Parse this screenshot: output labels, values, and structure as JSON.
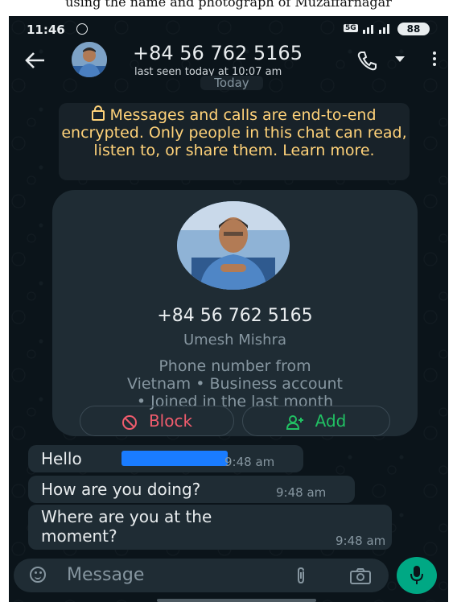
{
  "caption": "using the name and photograph of Muzaffarnagar",
  "status_bar": {
    "time": "11:46",
    "network_badge": "5G",
    "battery": "88"
  },
  "header": {
    "title": "+84 56 762 5165",
    "subtitle": "last seen today at 10:07 am"
  },
  "date_chip": "Today",
  "encryption_notice": "Messages and calls are end-to-end encrypted. Only people in this chat can read, listen to, or share them. Learn more.",
  "contact_card": {
    "phone": "+84 56 762 5165",
    "name": "Umesh Mishra",
    "info_line1": "Phone number from",
    "info_line2": "Vietnam • Business account",
    "info_line3": "• Joined in the last month",
    "block_label": "Block",
    "add_label": "Add"
  },
  "messages": [
    {
      "text": "Hello",
      "time": "9:48 am"
    },
    {
      "text": "How are you doing?",
      "time": "9:48 am"
    },
    {
      "text": "Where are you at the moment?",
      "time": "9:48 am"
    }
  ],
  "composer": {
    "placeholder": "Message"
  },
  "colors": {
    "background": "#0b141a",
    "bubble": "#1f2c34",
    "encryption_text": "#ffd279",
    "block": "#f15c6d",
    "accent": "#00a884",
    "redaction": "#1a7cff"
  }
}
